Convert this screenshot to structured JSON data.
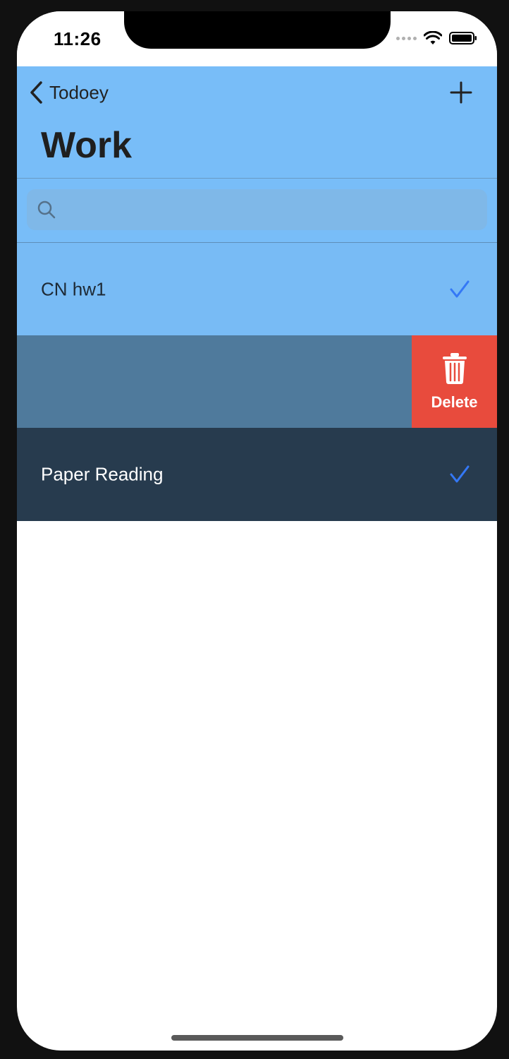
{
  "status_bar": {
    "time": "11:26"
  },
  "navigation": {
    "back_label": "Todoey",
    "title": "Work"
  },
  "search": {
    "placeholder": ""
  },
  "items": [
    {
      "label": "CN hw1",
      "checked": true
    },
    {
      "label": "",
      "checked": false
    },
    {
      "label": "Paper Reading",
      "checked": true
    }
  ],
  "swipe_action": {
    "label": "Delete"
  },
  "colors": {
    "nav_background": "#78bdf8",
    "row_1": "#78bbf5",
    "row_2": "#4f7a9c",
    "row_3": "#273b4e",
    "delete": "#e84b3d",
    "checkmark": "#3478f6"
  }
}
